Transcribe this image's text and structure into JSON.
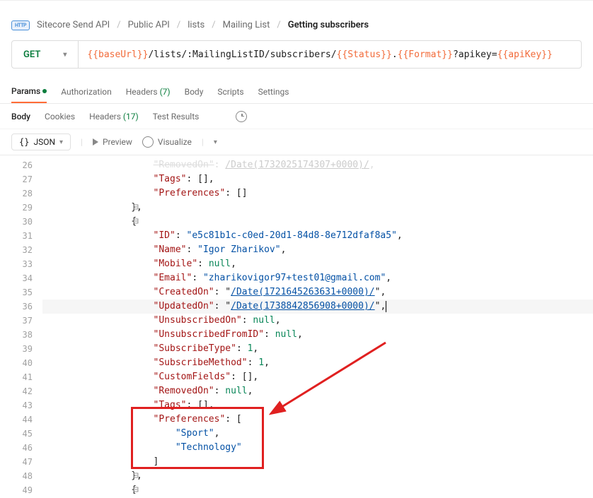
{
  "breadcrumb": {
    "icon": "HTTP",
    "items": [
      "Sitecore Send API",
      "Public API",
      "lists",
      "Mailing List"
    ],
    "current": "Getting subscribers"
  },
  "request": {
    "method": "GET",
    "url_parts": {
      "var1": "{{baseUrl}}",
      "p1": " /lists/:MailingListID/subscribers/ ",
      "var2": "{{Status}}",
      "p2": " . ",
      "var3": "{{Format}}",
      "p3": " ?apikey= ",
      "var4": "{{apiKey}}"
    }
  },
  "tabs": {
    "params": "Params",
    "auth": "Authorization",
    "headers": "Headers",
    "headers_count": "(7)",
    "body": "Body",
    "scripts": "Scripts",
    "settings": "Settings"
  },
  "subtabs": {
    "body": "Body",
    "cookies": "Cookies",
    "headers": "Headers",
    "headers_count": "(17)",
    "test": "Test Results"
  },
  "toolbar": {
    "json": "JSON",
    "preview": "Preview",
    "visualize": "Visualize"
  },
  "line_numbers": [
    "26",
    "27",
    "28",
    "29",
    "30",
    "31",
    "32",
    "33",
    "34",
    "35",
    "36",
    "37",
    "38",
    "39",
    "40",
    "41",
    "42",
    "43",
    "44",
    "45",
    "46",
    "47",
    "48",
    "49"
  ],
  "code": {
    "l26a": "                    \"RemovedOn\"",
    "l26b": ": ",
    "l26c": "\"/Date(1732025174307+0000)/\"",
    "l26d": ",",
    "l27a": "                    \"Tags\"",
    "l27b": ": [],",
    "l28a": "                    \"Preferences\"",
    "l28b": ": []",
    "l29": "                },",
    "l30": "                {",
    "l31a": "                    \"ID\"",
    "l31b": ": ",
    "l31c": "\"e5c81b1c-c0ed-20d1-84d8-8e712dfaf8a5\"",
    "l31d": ",",
    "l32a": "                    \"Name\"",
    "l32b": ": ",
    "l32c": "\"Igor Zharikov\"",
    "l32d": ",",
    "l33a": "                    \"Mobile\"",
    "l33b": ": ",
    "l33c": "null",
    "l33d": ",",
    "l34a": "                    \"Email\"",
    "l34b": ": ",
    "l34c": "\"zharikovigor97+test01@gmail.com\"",
    "l34d": ",",
    "l35a": "                    \"CreatedOn\"",
    "l35b": ": ",
    "l35c": "\"/Date(1721645263631+0000)/\"",
    "l35d": ",",
    "l36a": "                    \"UpdatedOn\"",
    "l36b": ": ",
    "l36c": "\"/Date(1738842856908+0000)/\"",
    "l36d": ",",
    "l37a": "                    \"UnsubscribedOn\"",
    "l37b": ": ",
    "l37c": "null",
    "l37d": ",",
    "l38a": "                    \"UnsubscribedFromID\"",
    "l38b": ": ",
    "l38c": "null",
    "l38d": ",",
    "l39a": "                    \"SubscribeType\"",
    "l39b": ": ",
    "l39c": "1",
    "l39d": ",",
    "l40a": "                    \"SubscribeMethod\"",
    "l40b": ": ",
    "l40c": "1",
    "l40d": ",",
    "l41a": "                    \"CustomFields\"",
    "l41b": ": [],",
    "l42a": "                    \"RemovedOn\"",
    "l42b": ": ",
    "l42c": "null",
    "l42d": ",",
    "l43a": "                    \"Tags\"",
    "l43b": ": [],",
    "l44a": "                    \"Preferences\"",
    "l44b": ": [",
    "l45": "                        \"Sport\"",
    "l45b": ",",
    "l46": "                        \"Technology\"",
    "l47": "                    ]",
    "l48": "                },",
    "l49": "                {"
  }
}
